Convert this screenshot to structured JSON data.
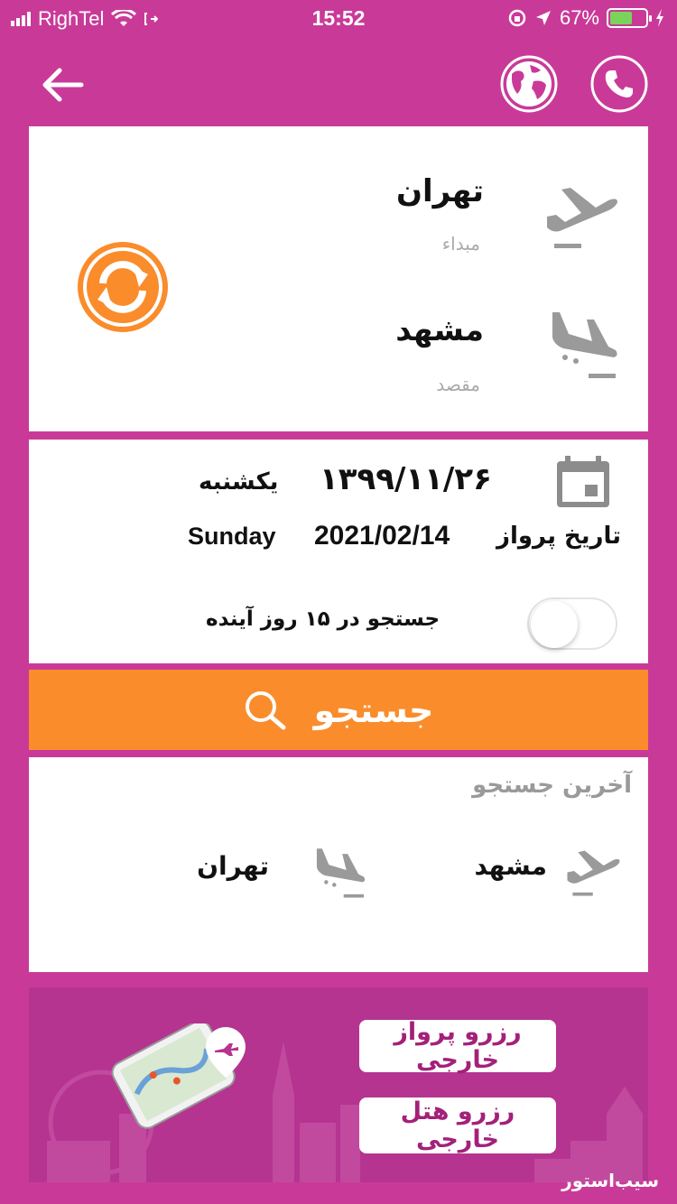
{
  "status_bar": {
    "carrier": "RighTel",
    "time": "15:52",
    "battery": "67%",
    "battery_level": 0.67
  },
  "header": {
    "back_icon": "arrow-left-icon",
    "globe_icon": "globe-icon",
    "phone_icon": "phone-icon"
  },
  "route": {
    "origin": {
      "city": "تهران",
      "label": "مبداء"
    },
    "destination": {
      "city": "مشهد",
      "label": "مقصد"
    },
    "swap_icon": "swap-icon"
  },
  "date": {
    "label": "تاریخ پرواز",
    "jalali_date": "۱۳۹۹/۱۱/۲۶",
    "jalali_day": "یکشنبه",
    "gregorian_date": "2021/02/14",
    "gregorian_day": "Sunday",
    "toggle_label": "جستجو در ۱۵ روز آینده",
    "toggle_on": false
  },
  "search": {
    "label": "جستجو"
  },
  "recent": {
    "title": "آخرین جستجو",
    "from": "مشهد",
    "to": "تهران"
  },
  "promo": {
    "flight_button": "رزرو پرواز خارجی",
    "hotel_button": "رزرو هتل خارجی"
  },
  "watermark": "سیب‌استور",
  "colors": {
    "background": "#c93a98",
    "accent": "#fa8c2b",
    "promo_bg": "#b53490",
    "promo_text": "#a3217a"
  }
}
